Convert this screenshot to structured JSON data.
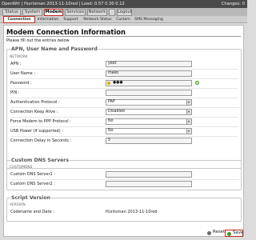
{
  "header": {
    "left_text": "OpenWrt | Huntsman 2013-11-10red | Load: 0.57 0.30 0.12",
    "right_text": "Changes: 0"
  },
  "main_tabs": [
    "Status",
    "System",
    "Modem",
    "Services",
    "Network",
    "",
    "Logout"
  ],
  "sub_tabs": [
    "Connection",
    "Information",
    "Support",
    "Network Status",
    "Custom",
    "SMS Messaging"
  ],
  "page": {
    "title": "Modem Connection Information",
    "intro": "Please fill out the entries below"
  },
  "apn_section": {
    "legend": "APN, User Name and Password",
    "label": "NETWORK",
    "fields": [
      {
        "label": "APN :",
        "value": "yext",
        "kind": "input"
      },
      {
        "label": "User Name :",
        "value": "mako",
        "kind": "input"
      },
      {
        "label": "Password :",
        "value": "●●●",
        "kind": "password"
      },
      {
        "label": "PIN :",
        "value": "",
        "kind": "input"
      },
      {
        "label": "Authentication Protocol :",
        "value": "PAP",
        "kind": "select"
      },
      {
        "label": "Connection Keep Alive :",
        "value": "Disabled",
        "kind": "select"
      },
      {
        "label": "Force Modem to PPP Protocol :",
        "value": "No",
        "kind": "select"
      },
      {
        "label": "USB Power (if supported) :",
        "value": "No",
        "kind": "select"
      },
      {
        "label": "Connection Delay in Seconds :",
        "value": "5",
        "kind": "input"
      }
    ]
  },
  "dns_section": {
    "legend": "Custom DNS Servers",
    "label": "CUSTOMDNS",
    "fields": [
      {
        "label": "Custom DNS Server1 :",
        "value": ""
      },
      {
        "label": "Custom DNS Server2 :",
        "value": ""
      }
    ]
  },
  "script_section": {
    "legend": "Script Version",
    "label": "VERSION",
    "codename_label": "Codename and Date :",
    "codename_value": "Huntsman 2013-11-10red"
  },
  "footer": {
    "reset_label": "Reset",
    "save_label": "Save"
  }
}
